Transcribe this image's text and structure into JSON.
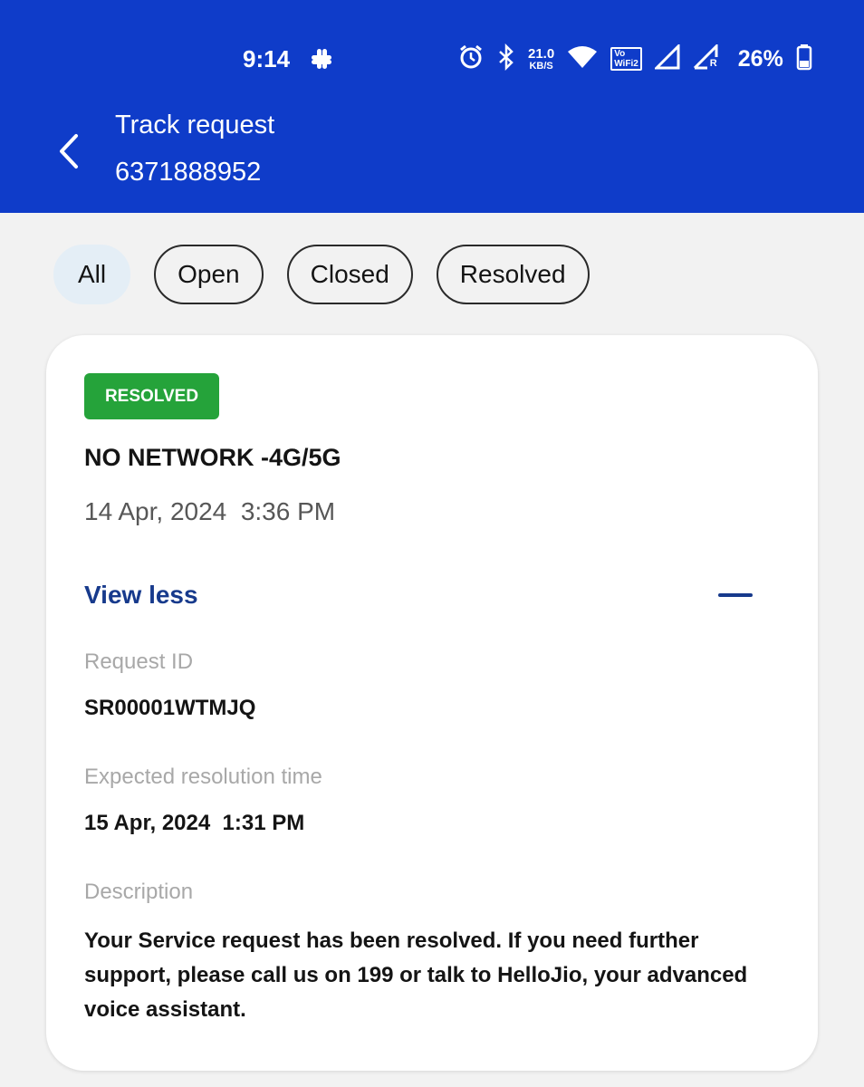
{
  "status_bar": {
    "time": "9:14",
    "speed_value": "21.0",
    "speed_unit": "KB/S",
    "vowifi_top": "Vo",
    "vowifi_bottom": "WiFi2",
    "roaming_indicator": "R",
    "battery": "26%"
  },
  "header": {
    "title": "Track request",
    "subtitle": "6371888952",
    "back_icon": "chevron-left-icon"
  },
  "filters": {
    "items": [
      {
        "label": "All",
        "active": true
      },
      {
        "label": "Open",
        "active": false
      },
      {
        "label": "Closed",
        "active": false
      },
      {
        "label": "Resolved",
        "active": false
      }
    ]
  },
  "request": {
    "status": "RESOLVED",
    "status_color": "#25a33a",
    "title": "NO NETWORK -4G/5G",
    "date": "14 Apr, 2024  3:36 PM",
    "toggle_label": "View less",
    "request_id_label": "Request ID",
    "request_id": "SR00001WTMJQ",
    "resolution_label": "Expected resolution time",
    "resolution_time": "15 Apr, 2024  1:31 PM",
    "description_label": "Description",
    "description": "Your Service request has been resolved. If you need further support, please call us on 199 or talk to HelloJio, your advanced voice assistant."
  },
  "colors": {
    "header_bg": "#0f3cc9",
    "accent_text": "#173a8c",
    "active_chip_bg": "#e4eef6"
  }
}
